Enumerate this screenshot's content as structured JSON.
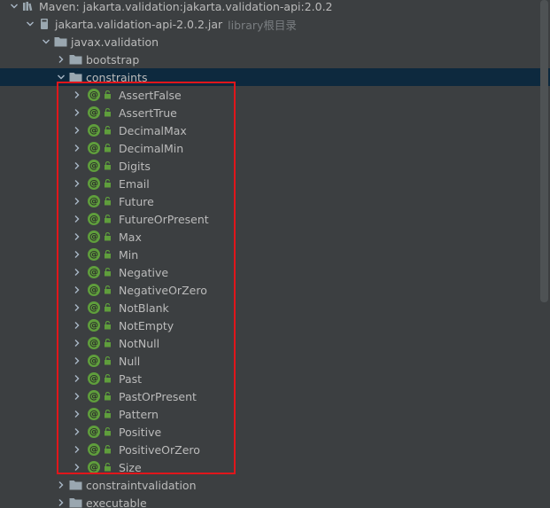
{
  "tree": {
    "root": {
      "label": "Maven: jakarta.validation:jakarta.validation-api:2.0.2"
    },
    "jar": {
      "label": "jakarta.validation-api-2.0.2.jar",
      "hint": "library根目录"
    },
    "package": {
      "label": "javax.validation"
    },
    "bootstrap": {
      "label": "bootstrap"
    },
    "constraints": {
      "label": "constraints"
    },
    "annotations": [
      "AssertFalse",
      "AssertTrue",
      "DecimalMax",
      "DecimalMin",
      "Digits",
      "Email",
      "Future",
      "FutureOrPresent",
      "Max",
      "Min",
      "Negative",
      "NegativeOrZero",
      "NotBlank",
      "NotEmpty",
      "NotNull",
      "Null",
      "Past",
      "PastOrPresent",
      "Pattern",
      "Positive",
      "PositiveOrZero",
      "Size"
    ],
    "constraintvalidation": {
      "label": "constraintvalidation"
    },
    "executable": {
      "label": "executable"
    },
    "annotation_badge": "@"
  },
  "colors": {
    "background": "#3c3f41",
    "selected_row": "#0d293e",
    "text": "#bbbbbb",
    "hint": "#7a7e81",
    "annotation_badge": "#5f9e3c",
    "highlight_border": "#e0161b"
  }
}
